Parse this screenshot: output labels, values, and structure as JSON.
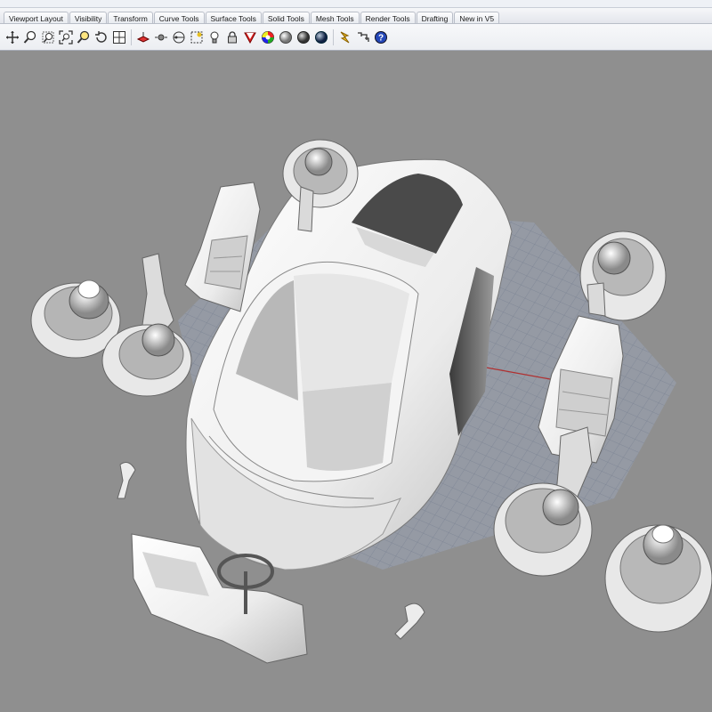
{
  "tabs": [
    {
      "label": "Viewport Layout"
    },
    {
      "label": "Visibility"
    },
    {
      "label": "Transform"
    },
    {
      "label": "Curve Tools"
    },
    {
      "label": "Surface Tools"
    },
    {
      "label": "Solid Tools"
    },
    {
      "label": "Mesh Tools"
    },
    {
      "label": "Render Tools"
    },
    {
      "label": "Drafting"
    },
    {
      "label": "New in V5"
    }
  ],
  "toolbar": {
    "icons": [
      "pan-icon",
      "zoom-dynamic-icon",
      "zoom-window-icon",
      "zoom-extents-icon",
      "zoom-selected-icon",
      "rotate-view-icon",
      "four-viewports-icon",
      "set-cplane-icon",
      "object-snap-icon",
      "grid-icon",
      "select-icon",
      "lights-icon",
      "lock-icon",
      "shade-icon",
      "render-color-icon",
      "render-sphere-icon",
      "render-sphere-dark-icon",
      "render-sphere-blue-icon",
      "flash-icon",
      "dimension-icon",
      "help-icon"
    ]
  },
  "colors": {
    "viewport_bg": "#8f8f8f",
    "grid": "#6f7a8a",
    "x_axis": "#b03030",
    "model": "#f2f2f2"
  }
}
